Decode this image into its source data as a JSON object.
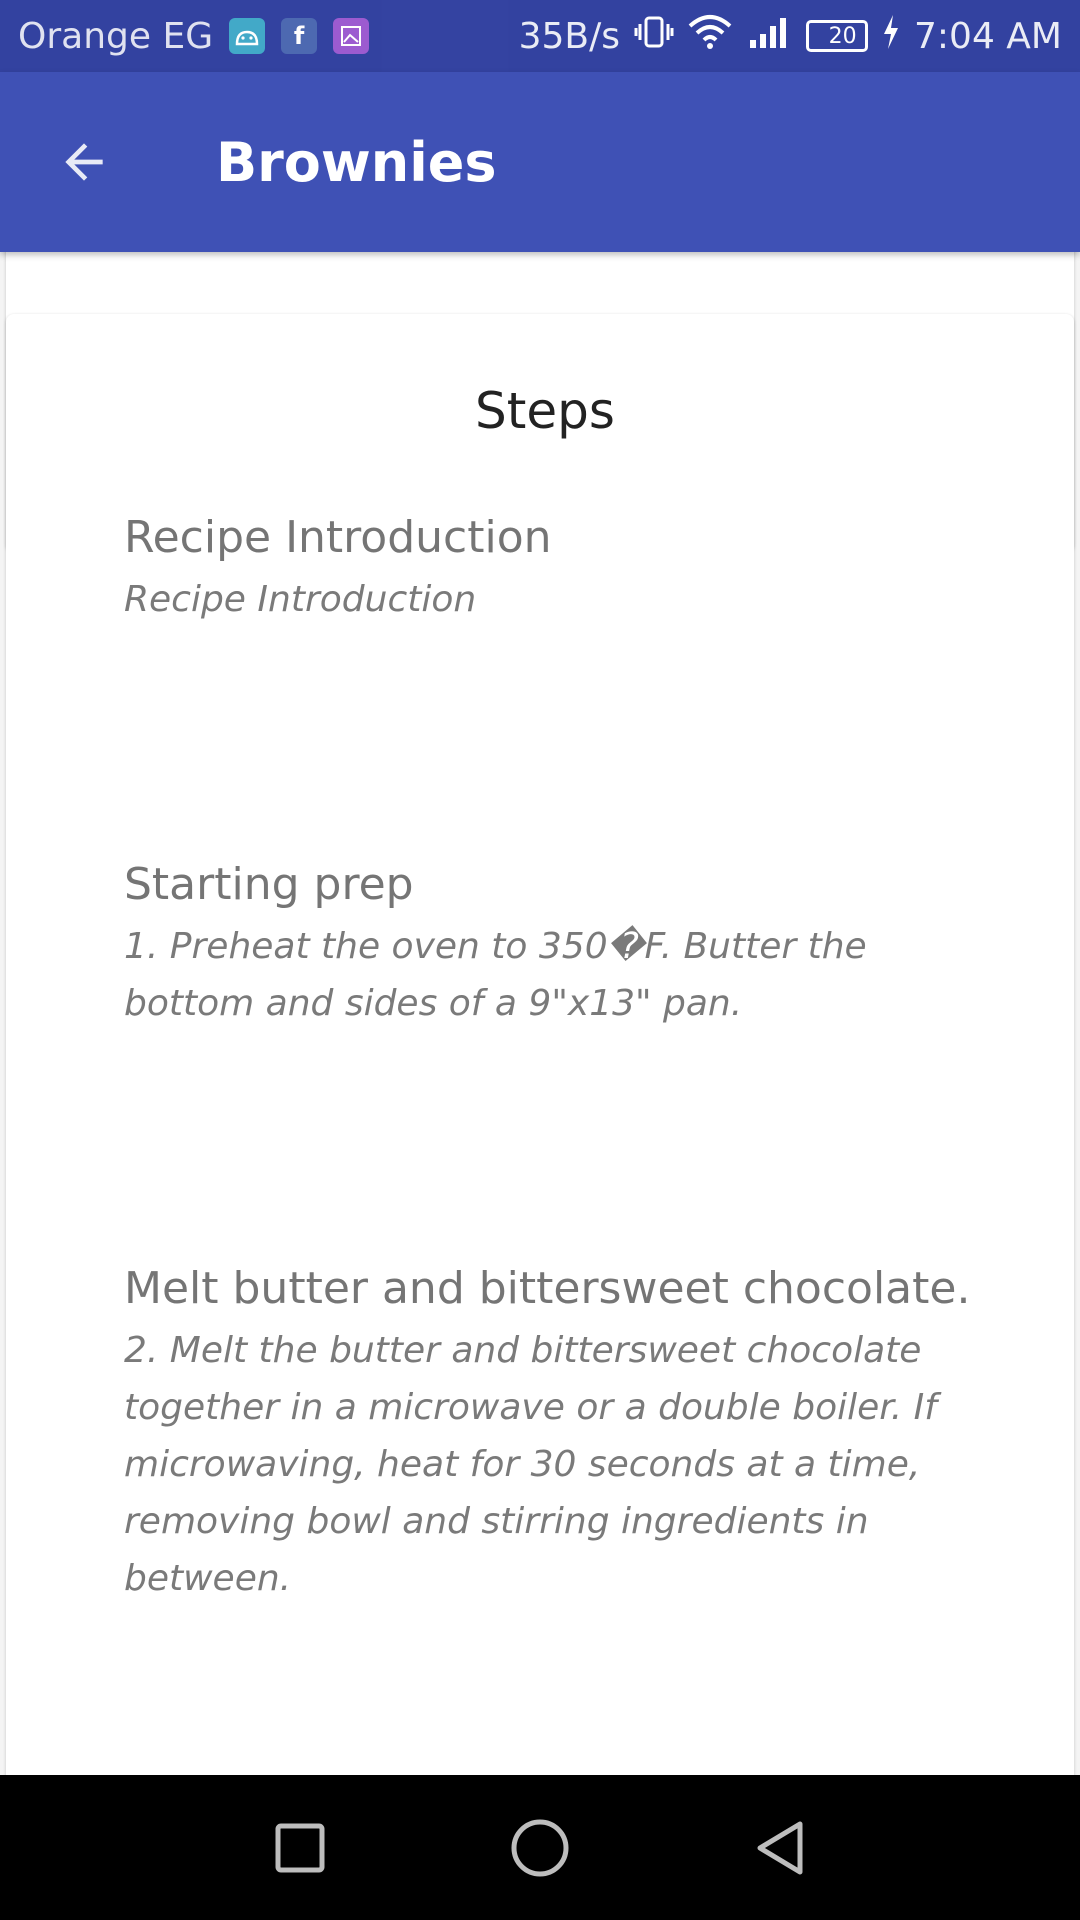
{
  "status_bar": {
    "carrier": "Orange EG",
    "speed": "35B/s",
    "battery": "20",
    "time": "7:04 AM",
    "notif_icons": [
      "android-icon",
      "facebook-icon",
      "gallery-icon"
    ]
  },
  "appbar": {
    "title": "Brownies",
    "back_icon": "arrow-back-icon"
  },
  "steps": {
    "heading": "Steps",
    "items": [
      {
        "title": "Recipe Introduction",
        "description": "Recipe Introduction"
      },
      {
        "title": "Starting prep",
        "description": "1. Preheat the oven to 350�F. Butter the bottom and sides of a 9\"x13\" pan."
      },
      {
        "title": "Melt butter and bittersweet chocolate.",
        "description": "2. Melt the butter and bittersweet chocolate together in a microwave or a double boiler. If microwaving, heat for 30 seconds at a time, removing bowl and stirring ingredients in between."
      }
    ]
  },
  "navbar": {
    "buttons": [
      "recents-icon",
      "home-icon",
      "back-icon"
    ]
  },
  "colors": {
    "primary": "#3f51b5",
    "primary_dark": "#303f9f"
  }
}
